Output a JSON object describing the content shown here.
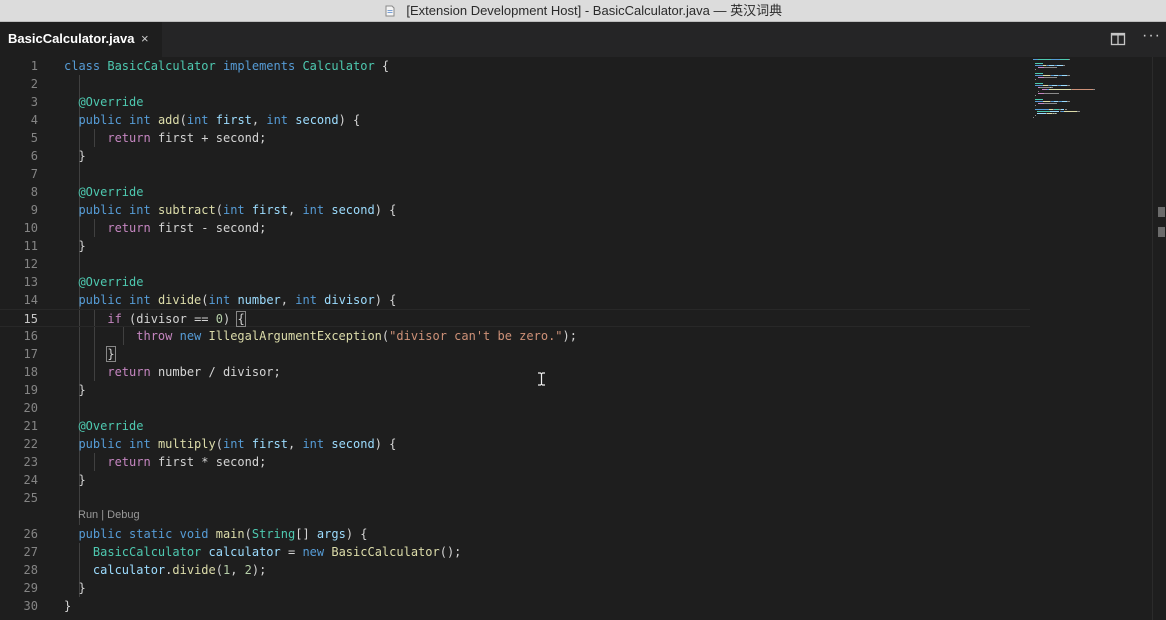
{
  "window": {
    "title": "[Extension Development Host] - BasicCalculator.java — 英汉词典",
    "icon": "document-icon"
  },
  "tabs": [
    {
      "label": "BasicCalculator.java",
      "close": "×",
      "active": true
    }
  ],
  "actions": {
    "split": "split-editor-icon",
    "more": "···"
  },
  "codelens": {
    "run": "Run",
    "separator": "|",
    "debug": "Debug"
  },
  "colors": {
    "background": "#1e1e1e",
    "keyword": "#569cd6",
    "control": "#c586c0",
    "type": "#4ec9b0",
    "function": "#dcdcaa",
    "variable": "#9cdcfe",
    "string": "#ce9178",
    "number": "#b5cea8",
    "text": "#d4d4d4"
  },
  "editor": {
    "current_line": 15,
    "lines": [
      {
        "n": "1",
        "tokens": [
          [
            "kw",
            "class "
          ],
          [
            "ty",
            "BasicCalculator "
          ],
          [
            "kw",
            "implements "
          ],
          [
            "ty",
            "Calculator "
          ],
          [
            "txt",
            "{"
          ]
        ]
      },
      {
        "n": "2",
        "tokens": []
      },
      {
        "n": "3",
        "tokens": [
          [
            "txt",
            "  "
          ],
          [
            "ann",
            "@Override"
          ]
        ]
      },
      {
        "n": "4",
        "tokens": [
          [
            "txt",
            "  "
          ],
          [
            "kw",
            "public "
          ],
          [
            "kw",
            "int "
          ],
          [
            "fn",
            "add"
          ],
          [
            "txt",
            "("
          ],
          [
            "kw",
            "int "
          ],
          [
            "prm",
            "first"
          ],
          [
            "txt",
            ", "
          ],
          [
            "kw",
            "int "
          ],
          [
            "prm",
            "second"
          ],
          [
            "txt",
            ") {"
          ]
        ]
      },
      {
        "n": "5",
        "tokens": [
          [
            "txt",
            "      "
          ],
          [
            "ctl",
            "return "
          ],
          [
            "txt",
            "first + second;"
          ]
        ]
      },
      {
        "n": "6",
        "tokens": [
          [
            "txt",
            "  }"
          ]
        ]
      },
      {
        "n": "7",
        "tokens": []
      },
      {
        "n": "8",
        "tokens": [
          [
            "txt",
            "  "
          ],
          [
            "ann",
            "@Override"
          ]
        ]
      },
      {
        "n": "9",
        "tokens": [
          [
            "txt",
            "  "
          ],
          [
            "kw",
            "public "
          ],
          [
            "kw",
            "int "
          ],
          [
            "fn",
            "subtract"
          ],
          [
            "txt",
            "("
          ],
          [
            "kw",
            "int "
          ],
          [
            "prm",
            "first"
          ],
          [
            "txt",
            ", "
          ],
          [
            "kw",
            "int "
          ],
          [
            "prm",
            "second"
          ],
          [
            "txt",
            ") {"
          ]
        ]
      },
      {
        "n": "10",
        "tokens": [
          [
            "txt",
            "      "
          ],
          [
            "ctl",
            "return "
          ],
          [
            "txt",
            "first - second;"
          ]
        ]
      },
      {
        "n": "11",
        "tokens": [
          [
            "txt",
            "  }"
          ]
        ]
      },
      {
        "n": "12",
        "tokens": []
      },
      {
        "n": "13",
        "tokens": [
          [
            "txt",
            "  "
          ],
          [
            "ann",
            "@Override"
          ]
        ]
      },
      {
        "n": "14",
        "tokens": [
          [
            "txt",
            "  "
          ],
          [
            "kw",
            "public "
          ],
          [
            "kw",
            "int "
          ],
          [
            "fn",
            "divide"
          ],
          [
            "txt",
            "("
          ],
          [
            "kw",
            "int "
          ],
          [
            "prm",
            "number"
          ],
          [
            "txt",
            ", "
          ],
          [
            "kw",
            "int "
          ],
          [
            "prm",
            "divisor"
          ],
          [
            "txt",
            ") {"
          ]
        ]
      },
      {
        "n": "15",
        "tokens": [
          [
            "txt",
            "      "
          ],
          [
            "ctl",
            "if "
          ],
          [
            "txt",
            "(divisor == "
          ],
          [
            "num",
            "0"
          ],
          [
            "txt",
            ") "
          ],
          [
            "match",
            "{"
          ]
        ]
      },
      {
        "n": "16",
        "tokens": [
          [
            "txt",
            "          "
          ],
          [
            "ctl",
            "throw "
          ],
          [
            "kw",
            "new "
          ],
          [
            "fn",
            "IllegalArgumentException"
          ],
          [
            "txt",
            "("
          ],
          [
            "str",
            "\"divisor can't be zero.\""
          ],
          [
            "txt",
            ");"
          ]
        ]
      },
      {
        "n": "17",
        "tokens": [
          [
            "txt",
            "      "
          ],
          [
            "match",
            "}"
          ]
        ]
      },
      {
        "n": "18",
        "tokens": [
          [
            "txt",
            "      "
          ],
          [
            "ctl",
            "return "
          ],
          [
            "txt",
            "number / divisor;"
          ]
        ]
      },
      {
        "n": "19",
        "tokens": [
          [
            "txt",
            "  }"
          ]
        ]
      },
      {
        "n": "20",
        "tokens": []
      },
      {
        "n": "21",
        "tokens": [
          [
            "txt",
            "  "
          ],
          [
            "ann",
            "@Override"
          ]
        ]
      },
      {
        "n": "22",
        "tokens": [
          [
            "txt",
            "  "
          ],
          [
            "kw",
            "public "
          ],
          [
            "kw",
            "int "
          ],
          [
            "fn",
            "multiply"
          ],
          [
            "txt",
            "("
          ],
          [
            "kw",
            "int "
          ],
          [
            "prm",
            "first"
          ],
          [
            "txt",
            ", "
          ],
          [
            "kw",
            "int "
          ],
          [
            "prm",
            "second"
          ],
          [
            "txt",
            ") {"
          ]
        ]
      },
      {
        "n": "23",
        "tokens": [
          [
            "txt",
            "      "
          ],
          [
            "ctl",
            "return "
          ],
          [
            "txt",
            "first * second;"
          ]
        ]
      },
      {
        "n": "24",
        "tokens": [
          [
            "txt",
            "  }"
          ]
        ]
      },
      {
        "n": "25",
        "tokens": []
      },
      {
        "n": "26",
        "tokens": [
          [
            "txt",
            "  "
          ],
          [
            "kw",
            "public "
          ],
          [
            "kw",
            "static "
          ],
          [
            "kw",
            "void "
          ],
          [
            "fn",
            "main"
          ],
          [
            "txt",
            "("
          ],
          [
            "ty",
            "String"
          ],
          [
            "txt",
            "[] "
          ],
          [
            "prm",
            "args"
          ],
          [
            "txt",
            ") {"
          ]
        ]
      },
      {
        "n": "27",
        "tokens": [
          [
            "txt",
            "    "
          ],
          [
            "ty",
            "BasicCalculator "
          ],
          [
            "prm",
            "calculator"
          ],
          [
            "txt",
            " = "
          ],
          [
            "kw",
            "new "
          ],
          [
            "fn",
            "BasicCalculator"
          ],
          [
            "txt",
            "();"
          ]
        ]
      },
      {
        "n": "28",
        "tokens": [
          [
            "txt",
            "    "
          ],
          [
            "prm",
            "calculator"
          ],
          [
            "txt",
            "."
          ],
          [
            "fn",
            "divide"
          ],
          [
            "txt",
            "("
          ],
          [
            "num",
            "1"
          ],
          [
            "txt",
            ", "
          ],
          [
            "num",
            "2"
          ],
          [
            "txt",
            ");"
          ]
        ]
      },
      {
        "n": "29",
        "tokens": [
          [
            "txt",
            "  }"
          ]
        ]
      },
      {
        "n": "30",
        "tokens": [
          [
            "txt",
            "}"
          ]
        ]
      }
    ]
  }
}
